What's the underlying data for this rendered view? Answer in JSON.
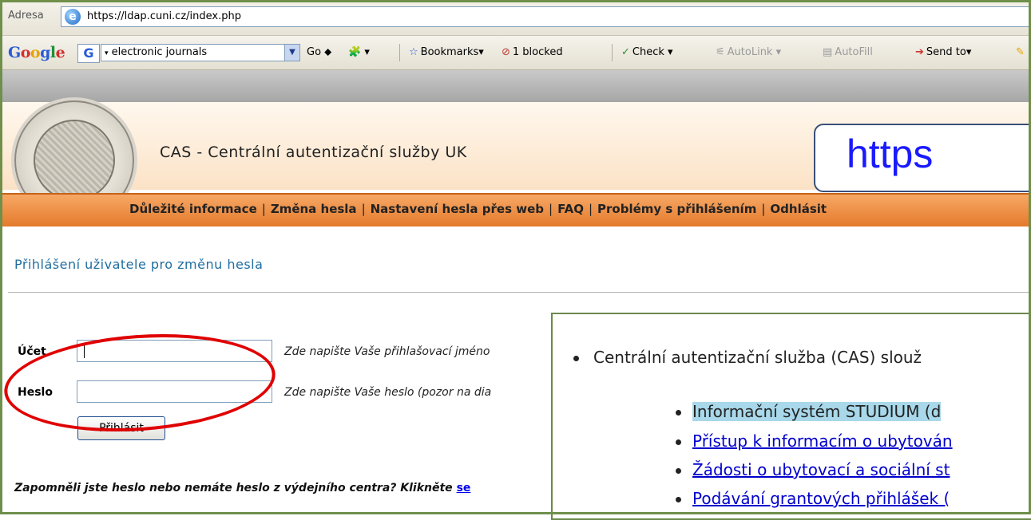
{
  "address_bar": {
    "label": "Adresa",
    "url": "https://ldap.cuni.cz/index.php"
  },
  "google_toolbar": {
    "logo": "Google",
    "search_value": "electronic journals",
    "go": "Go",
    "bookmarks": "Bookmarks",
    "blocked": "1 blocked",
    "check": "Check",
    "autolink": "AutoLink",
    "autofill": "AutoFill",
    "send_to": "Send to"
  },
  "header": {
    "title": "CAS - Centrální autentizační služby UK",
    "nav": [
      "Důležité informace",
      "Změna hesla",
      "Nastavení hesla přes web",
      "FAQ",
      "Problémy s přihlášením",
      "Odhlásit"
    ]
  },
  "callout": {
    "text": "https"
  },
  "login": {
    "heading": "Přihlášení uživatele pro změnu hesla",
    "account_label": "Účet",
    "account_value": "",
    "account_hint": "Zde napište Vaše přihlašovací jméno",
    "password_label": "Heslo",
    "password_value": "",
    "password_hint": "Zde napište Vaše heslo (pozor na dia",
    "submit": "Přihlásit",
    "forgot_text": "Zapomněli jste heslo nebo nemáte heslo z výdejního centra? Klikněte ",
    "forgot_link": "se"
  },
  "info_panel": {
    "main": "Centrální autentizační služba (CAS) slouž",
    "items": [
      {
        "text": "Informační systém STUDIUM (d",
        "style": "highlight"
      },
      {
        "text": "Přístup k informacím o ubytován",
        "style": "link"
      },
      {
        "text": "Žádosti o ubytovací a sociální st",
        "style": "link"
      },
      {
        "text": "Podávání grantových přihlášek (",
        "style": "link"
      }
    ]
  },
  "colors": {
    "nav_orange": "#e47a2c",
    "heading_blue": "#1f6ea0",
    "annotation_red": "#e00000",
    "callout_text": "#1a1aff",
    "highlight": "#a8d8ea"
  }
}
